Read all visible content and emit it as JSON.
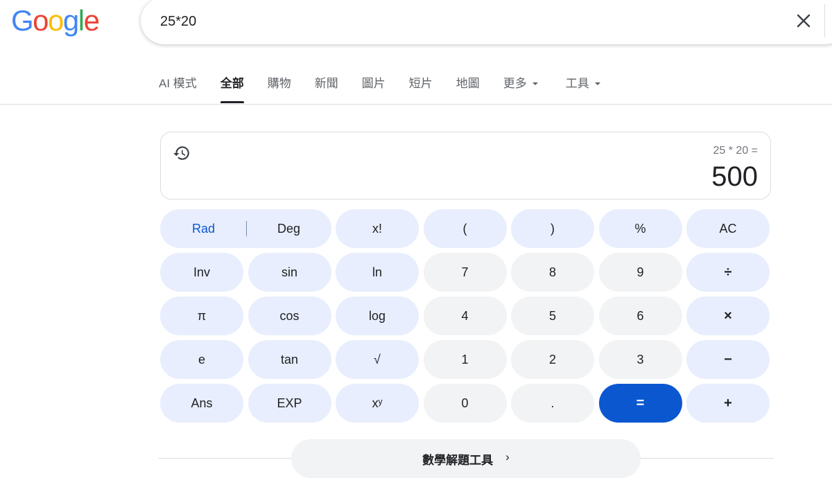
{
  "logo": {
    "letters": [
      "G",
      "o",
      "o",
      "g",
      "l",
      "e"
    ]
  },
  "search": {
    "query": "25*20",
    "clear_icon": "close-icon"
  },
  "tabs": [
    {
      "label": "AI 模式",
      "active": false
    },
    {
      "label": "全部",
      "active": true
    },
    {
      "label": "購物",
      "active": false
    },
    {
      "label": "新聞",
      "active": false
    },
    {
      "label": "圖片",
      "active": false
    },
    {
      "label": "短片",
      "active": false
    },
    {
      "label": "地圖",
      "active": false
    },
    {
      "label": "更多",
      "active": false,
      "dropdown": true
    },
    {
      "label": "工具",
      "active": false,
      "dropdown": true
    }
  ],
  "calculator": {
    "history_icon": "history-icon",
    "expression": "25 * 20 =",
    "result": "500",
    "keys": {
      "rad": "Rad",
      "deg": "Deg",
      "fact": "x!",
      "lparen": "(",
      "rparen": ")",
      "percent": "%",
      "ac": "AC",
      "inv": "Inv",
      "sin": "sin",
      "ln": "ln",
      "k7": "7",
      "k8": "8",
      "k9": "9",
      "divide": "÷",
      "pi": "π",
      "cos": "cos",
      "log": "log",
      "k4": "4",
      "k5": "5",
      "k6": "6",
      "multiply": "×",
      "e": "e",
      "tan": "tan",
      "sqrt": "√",
      "k1": "1",
      "k2": "2",
      "k3": "3",
      "minus": "−",
      "ans": "Ans",
      "exp": "EXP",
      "pow": "xʸ",
      "k0": "0",
      "dot": ".",
      "equals": "=",
      "plus": "+"
    },
    "colors": {
      "accent": "#0b57d0",
      "fn_key_bg": "#e8eefd",
      "num_key_bg": "#f1f3f4"
    }
  },
  "footer": {
    "math_tool_label": "數學解題工具",
    "chevron": "›"
  }
}
